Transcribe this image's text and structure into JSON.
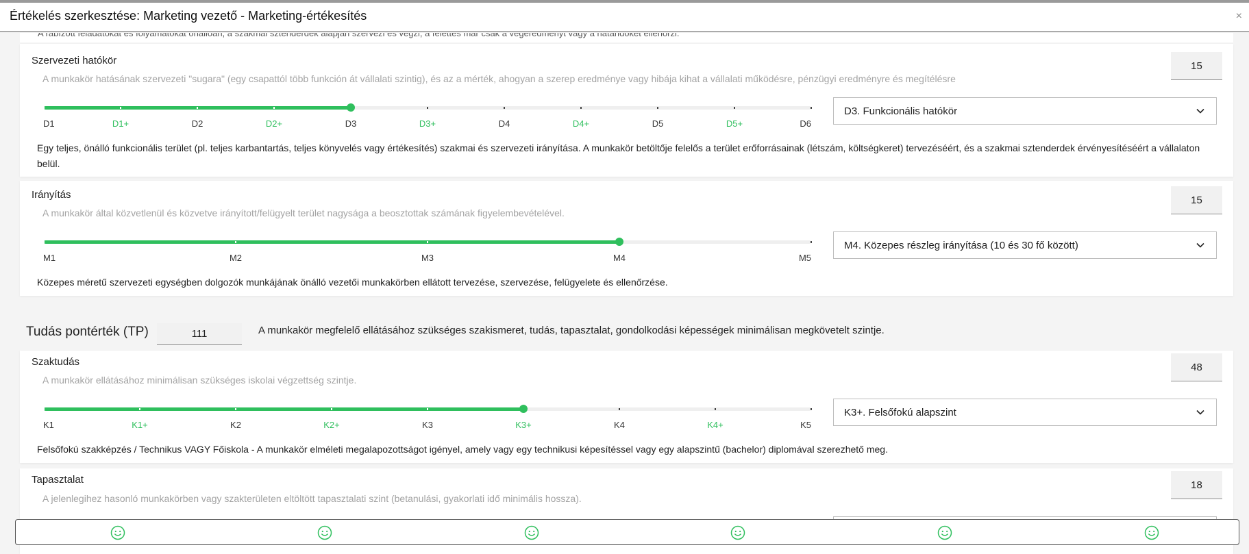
{
  "window": {
    "title": "Értékelés szerkesztése: Marketing vezető - Marketing-értékesítés",
    "close_label": "×"
  },
  "cut_card": {
    "text": "A rábízott feladatokat és folyamatokat önállóan, a szakmai sztenderdek alapján szervezi és végzi, a felettes már csak a végeredményt vagy a határidőket ellenőrzi."
  },
  "cards": {
    "szervezeti": {
      "title": "Szervezeti hatókör",
      "subtitle": "A munkakör hatásának szervezeti \"sugara\" (egy csapattól több funkción át vállalati szintig), és az a mérték, ahogyan a szerep eredménye vagy hibája kihat a vállalati működésre, pénzügyi eredményre és megítélésre",
      "score": "15",
      "levels": [
        "D1",
        "D1+",
        "D2",
        "D2+",
        "D3",
        "D3+",
        "D4",
        "D4+",
        "D5",
        "D5+",
        "D6"
      ],
      "selected_index": 4,
      "selected_value": "D3. Funkcionális hatókör",
      "description": "Egy teljes, önálló funkcionális terület (pl. teljes karbantartás, teljes könyvelés vagy értékesítés) szakmai és szervezeti irányítása. A munkakör betöltője felelős a terület erőforrásainak (létszám, költségkeret) tervezéséért, és a szakmai sztenderdek érvényesítéséért a vállalaton belül."
    },
    "iranyitas": {
      "title": "Irányítás",
      "subtitle": "A munkakör által közvetlenül és közvetve irányított/felügyelt terület nagysága a beosztottak számának figyelembevételével.",
      "score": "15",
      "levels": [
        "M1",
        "M2",
        "M3",
        "M4",
        "M5"
      ],
      "selected_index": 3,
      "selected_value": "M4. Közepes részleg irányítása (10 és 30 fő között)",
      "description": "Közepes méretű szervezeti egységben dolgozók munkájának önálló vezetői munkakörben ellátott tervezése, szervezése, felügyelete és ellenőrzése."
    },
    "szaktudas": {
      "title": "Szaktudás",
      "subtitle": "A munkakör ellátásához minimálisan szükséges iskolai végzettség szintje.",
      "score": "48",
      "levels": [
        "K1",
        "K1+",
        "K2",
        "K2+",
        "K3",
        "K3+",
        "K4",
        "K4+",
        "K5"
      ],
      "selected_index": 5,
      "selected_value": "K3+. Felsőfokú alapszint",
      "description": "Felsőfokú szakképzés / Technikus VAGY Főiskola - A munkakör elméleti megalapozottságot igényel, amely vagy egy technikusi képesítéssel vagy egy alapszintű (bachelor) diplomával szerezhető meg."
    },
    "tapasztalat": {
      "title": "Tapasztalat",
      "subtitle": "A jelenlegihez hasonló munkakörben vagy szakterületen eltöltött tapasztalati szint (betanulási, gyakorlati idő minimális hossza).",
      "score": "18"
    }
  },
  "tudas": {
    "title": "Tudás pontérték (TP)",
    "value": "111",
    "description": "A munkakör megfelelő ellátásához szükséges szakismeret, tudás, tapasztalat, gondolkodási képességek minimálisan megkövetelt szintje."
  },
  "smiley_bar": {
    "count": 6,
    "icon": "smiley-icon",
    "color": "#2fbf5d"
  },
  "colors": {
    "accent": "#2fbf5d",
    "muted_text": "#a3a3a3"
  }
}
